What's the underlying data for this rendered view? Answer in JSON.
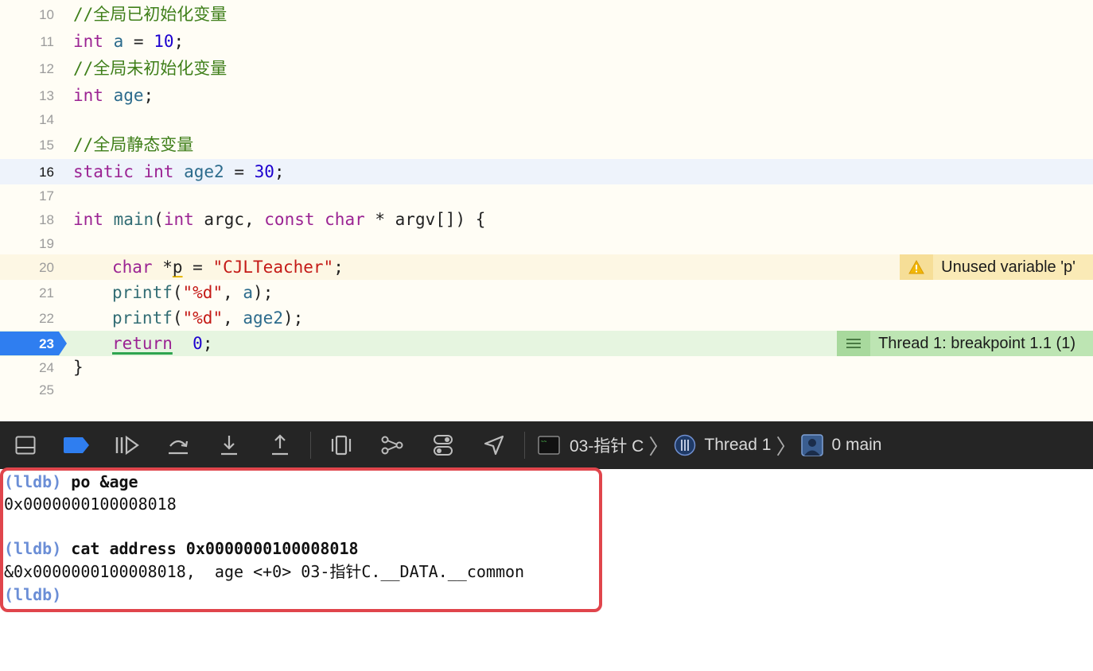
{
  "editor": {
    "lines": [
      {
        "num": "10",
        "text": "//全局已初始化变量"
      },
      {
        "num": "11",
        "kw1": "int",
        "var": "a",
        "eq": " = ",
        "numval": "10",
        "end": ";"
      },
      {
        "num": "12",
        "text": "//全局未初始化变量"
      },
      {
        "num": "13",
        "kw1": "int",
        "var": "age",
        "end": ";"
      },
      {
        "num": "14"
      },
      {
        "num": "15",
        "text": "//全局静态变量"
      },
      {
        "num": "16",
        "kw1": "static",
        "kw2": "int",
        "var": "age2",
        "eq": " = ",
        "numval": "30",
        "end": ";"
      },
      {
        "num": "17"
      },
      {
        "num": "18",
        "kw1": "int",
        "fn": "main",
        "open": "(",
        "kw2": "int",
        "a1": " argc, ",
        "kw3": "const",
        "kw4": "char",
        "rest": " * argv[]) {"
      },
      {
        "num": "19"
      },
      {
        "num": "20",
        "kw1": "char",
        "star": " *",
        "p": "p",
        "eq": " = ",
        "str": "\"CJLTeacher\"",
        "end": ";"
      },
      {
        "num": "21",
        "fn": "printf",
        "open": "(",
        "str": "\"%d\"",
        "mid": ", ",
        "var": "a",
        "end": ");"
      },
      {
        "num": "22",
        "fn": "printf",
        "open": "(",
        "str": "\"%d\"",
        "mid": ", ",
        "var": "age2",
        "end": ");"
      },
      {
        "num": "23",
        "kw1": "return",
        "sp": "  ",
        "numval": "0",
        "end": ";"
      },
      {
        "num": "24",
        "text": "}"
      },
      {
        "num": "25"
      }
    ],
    "warning_text": "Unused variable 'p'",
    "breakpoint_text": "Thread 1: breakpoint 1.1 (1)"
  },
  "debugbar": {
    "process": "03-指针 C",
    "thread": "Thread 1",
    "frame": "0 main"
  },
  "console": {
    "prompt": "(lldb)",
    "cmd1": " po &age",
    "out1": "0x0000000100008018",
    "cmd2": " cat address 0x0000000100008018",
    "out2": "&0x0000000100008018,  age <+0> 03-指针C.__DATA.__common"
  },
  "colors": {
    "keyword": "#9b2393",
    "number": "#1c00cf",
    "string": "#c41a16",
    "comment": "#3f7f1a",
    "breakpoint": "#2f7ef0",
    "highlight_box": "#e0454c",
    "prompt": "#6b8ed6"
  }
}
